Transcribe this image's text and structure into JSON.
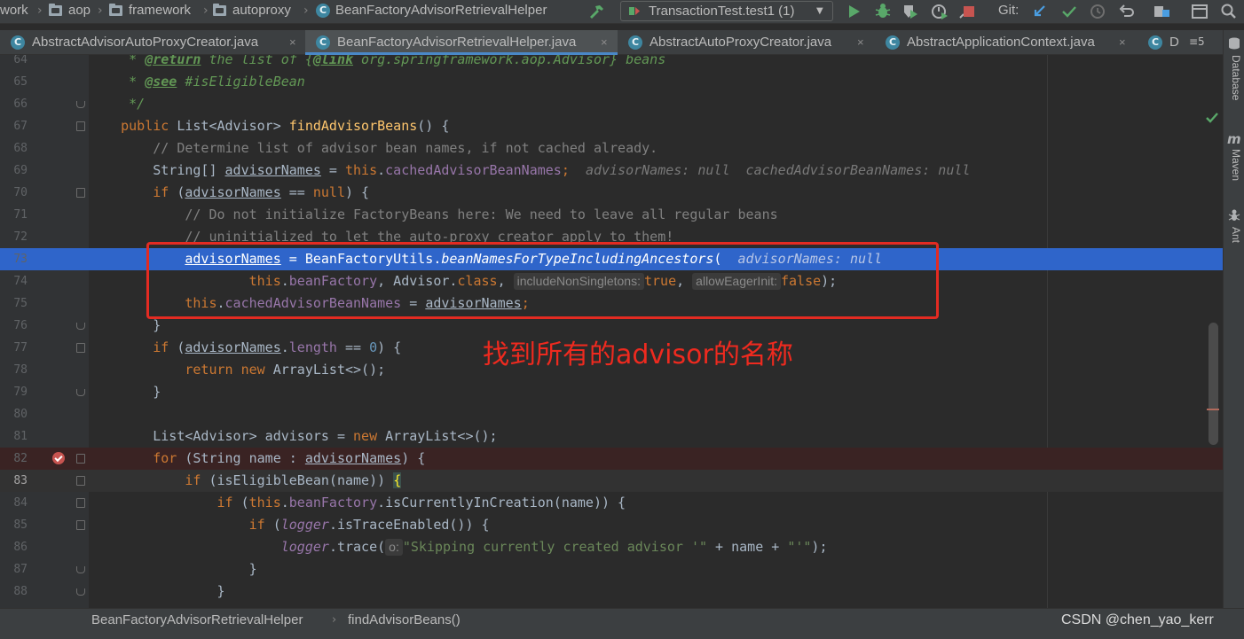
{
  "nav": {
    "crumbs": [
      "work",
      "aop",
      "framework",
      "autoproxy",
      "BeanFactoryAdvisorRetrievalHelper"
    ],
    "run_config": "TransactionTest.test1 (1)",
    "git_label": "Git:"
  },
  "tabs": [
    {
      "label": "AbstractAdvisorAutoProxyCreator.java",
      "close": "×"
    },
    {
      "label": "BeanFactoryAdvisorRetrievalHelper.java",
      "close": "×"
    },
    {
      "label": "AbstractAutoProxyCreator.java",
      "close": "×"
    },
    {
      "label": "AbstractApplicationContext.java",
      "close": "×"
    },
    {
      "label": "D",
      "close": ""
    }
  ],
  "tab_overflow": "≡5",
  "tool_windows": [
    "Database",
    "Maven",
    "Ant"
  ],
  "line_numbers": [
    "64",
    "65",
    "66",
    "67",
    "68",
    "69",
    "70",
    "71",
    "72",
    "73",
    "74",
    "75",
    "76",
    "77",
    "78",
    "79",
    "80",
    "81",
    "82",
    "83",
    "84",
    "85",
    "86",
    "87",
    "88"
  ],
  "code": {
    "l64_tag": "@return",
    "l64_a": " the list of {",
    "l64_link": "@link",
    "l64_b": " org.springframework.aop.Advisor} beans",
    "l65_tag": "@see",
    "l65_b": " #isEligibleBean",
    "l66": "*/",
    "l67_kw": "public ",
    "l67_a": "List<Advisor> ",
    "l67_fn": "findAdvisorBeans",
    "l67_b": "() {",
    "l68": "// Determine list of advisor bean names, if not cached already.",
    "l69_a": "String[] ",
    "l69_var": "advisorNames",
    "l69_b": " = ",
    "l69_kw": "this",
    "l69_c": ".",
    "l69_fld": "cachedAdvisorBeanNames",
    "l69_d": ";",
    "l69_inline": "advisorNames: null  cachedAdvisorBeanNames: null",
    "l70_kw": "if",
    "l70_a": " (",
    "l70_var": "advisorNames",
    "l70_b": " == ",
    "l70_kw2": "null",
    "l70_c": ") {",
    "l71": "// Do not initialize FactoryBeans here: We need to leave all regular beans",
    "l72": "// uninitialized to let the auto-proxy creator apply to them!",
    "l73_var": "advisorNames",
    "l73_a": " = BeanFactoryUtils.",
    "l73_st": "beanNamesForTypeIncludingAncestors",
    "l73_b": "(",
    "l73_inline": "advisorNames: null",
    "l74_kw": "this",
    "l74_a": ".",
    "l74_fld": "beanFactory",
    "l74_b": ", Advisor.",
    "l74_kw2": "class",
    "l74_c": ", ",
    "l74_hint1": "includeNonSingletons:",
    "l74_kw3": "true",
    "l74_d": ", ",
    "l74_hint2": "allowEagerInit:",
    "l74_kw4": "false",
    "l74_e": ");",
    "l75_kw": "this",
    "l75_a": ".",
    "l75_fld": "cachedAdvisorBeanNames",
    "l75_b": " = ",
    "l75_var": "advisorNames",
    "l75_c": ";",
    "l76": "}",
    "l77_kw": "if",
    "l77_a": " (",
    "l77_var": "advisorNames",
    "l77_b": ".",
    "l77_fld": "length",
    "l77_c": " == ",
    "l77_num": "0",
    "l77_d": ") {",
    "l78_kw": "return new ",
    "l78_a": "ArrayList<>();",
    "l79": "}",
    "l81_a": "List<Advisor> advisors = ",
    "l81_kw": "new ",
    "l81_b": "ArrayList<>();",
    "l82_kw": "for",
    "l82_a": " (String name : ",
    "l82_var": "advisorNames",
    "l82_b": ") {",
    "l83_kw": "if",
    "l83_a": " (isEligibleBean(name)) ",
    "l83_b": "{",
    "l84_kw": "if",
    "l84_a": " (",
    "l84_kw2": "this",
    "l84_b": ".",
    "l84_fld": "beanFactory",
    "l84_c": ".isCurrentlyInCreation(name)) {",
    "l85_kw": "if",
    "l85_a": " (",
    "l85_st": "logger",
    "l85_b": ".isTraceEnabled()) {",
    "l86_st": "logger",
    "l86_a": ".trace(",
    "l86_hint": "o:",
    "l86_str": "\"Skipping currently created advisor '\"",
    "l86_b": " + name + ",
    "l86_str2": "\"'\"",
    "l86_c": ");",
    "l87": "}",
    "l88": "}"
  },
  "annotation": "找到所有的advisor的名称",
  "status": {
    "class_crumb": "BeanFactoryAdvisorRetrievalHelper",
    "sep": "›",
    "method_crumb": "findAdvisorBeans()",
    "watermark": "CSDN @chen_yao_kerr"
  },
  "colors": {
    "selection": "#2f65ca",
    "breakpoint": "#c75450",
    "annotation": "#ee2a1f"
  }
}
